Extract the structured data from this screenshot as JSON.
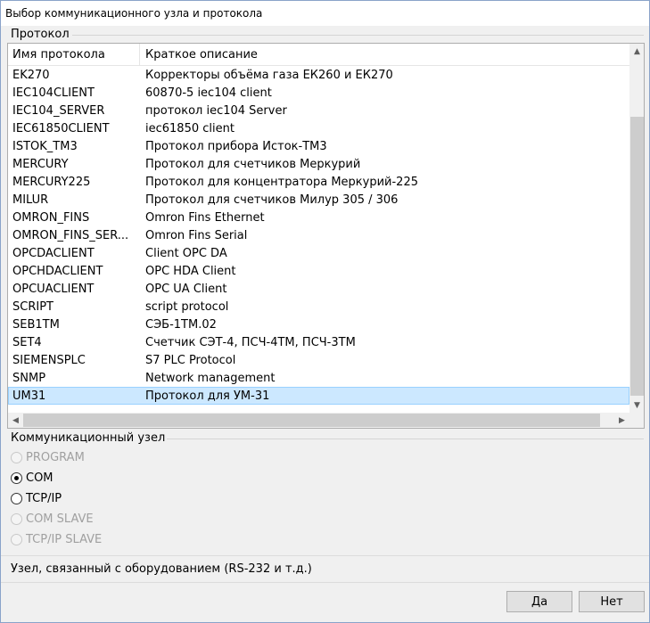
{
  "window": {
    "title": "Выбор коммуникационного узла и протокола"
  },
  "protocol_group": {
    "label": "Протокол",
    "columns": [
      "Имя протокола",
      "Краткое описание"
    ],
    "rows": [
      {
        "name": "EK270",
        "desc": "Корректоры объёма газа ЕК260 и ЕК270"
      },
      {
        "name": "IEC104CLIENT",
        "desc": "60870-5 iec104 client"
      },
      {
        "name": "IEC104_SERVER",
        "desc": "протокол iec104 Server"
      },
      {
        "name": "IEC61850CLIENT",
        "desc": "iec61850 client"
      },
      {
        "name": "ISTOK_TM3",
        "desc": "Протокол прибора Исток-ТМ3"
      },
      {
        "name": "MERCURY",
        "desc": "Протокол для счетчиков Меркурий"
      },
      {
        "name": "MERCURY225",
        "desc": "Протокол для концентратора Меркурий-225"
      },
      {
        "name": "MILUR",
        "desc": "Протокол для счетчиков Милур 305 / 306"
      },
      {
        "name": "OMRON_FINS",
        "desc": "Omron Fins Ethernet"
      },
      {
        "name": "OMRON_FINS_SER...",
        "desc": "Omron Fins Serial"
      },
      {
        "name": "OPCDACLIENT",
        "desc": "Client OPC DA"
      },
      {
        "name": "OPCHDACLIENT",
        "desc": "OPC HDA Client"
      },
      {
        "name": "OPCUACLIENT",
        "desc": "OPC UA Client"
      },
      {
        "name": "SCRIPT",
        "desc": "script protocol"
      },
      {
        "name": "SEB1TM",
        "desc": "СЭБ-1ТМ.02"
      },
      {
        "name": "SET4",
        "desc": "Счетчик СЭТ-4, ПСЧ-4ТМ, ПСЧ-3ТМ"
      },
      {
        "name": "SIEMENSPLC",
        "desc": "S7 PLC Protocol"
      },
      {
        "name": "SNMP",
        "desc": "Network management"
      },
      {
        "name": "UM31",
        "desc": "Протокол для УМ-31",
        "selected": true
      }
    ]
  },
  "node_group": {
    "label": "Коммуникационный узел",
    "options": [
      {
        "label": "PROGRAM",
        "checked": false,
        "disabled": true
      },
      {
        "label": "COM",
        "checked": true,
        "disabled": false
      },
      {
        "label": "TCP/IP",
        "checked": false,
        "disabled": false
      },
      {
        "label": "COM SLAVE",
        "checked": false,
        "disabled": true
      },
      {
        "label": "TCP/IP SLAVE",
        "checked": false,
        "disabled": true
      }
    ]
  },
  "description": "Узел, связанный с оборудованием (RS-232 и т.д.)",
  "buttons": {
    "ok": "Да",
    "cancel": "Нет"
  },
  "icons": {
    "scroll_up": "▲",
    "scroll_down": "▼",
    "scroll_left": "◀",
    "scroll_right": "▶"
  }
}
